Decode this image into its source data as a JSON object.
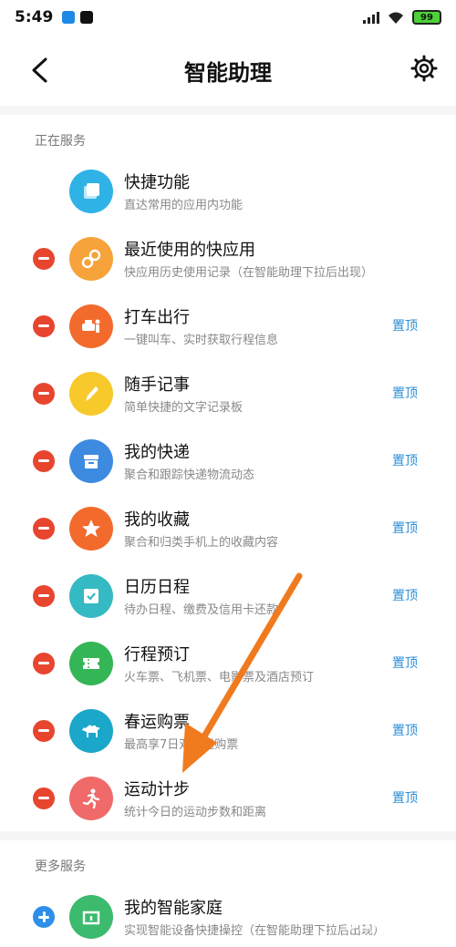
{
  "status": {
    "time": "5:49",
    "battery": "99"
  },
  "header": {
    "title": "智能助理"
  },
  "sections": {
    "serving_title": "正在服务",
    "more_title": "更多服务"
  },
  "items": [
    {
      "title": "快捷功能",
      "sub": "直达常用的应用内功能",
      "color": "#2fb3e6",
      "icon": "layers-icon"
    },
    {
      "title": "最近使用的快应用",
      "sub": "快应用历史使用记录（在智能助理下拉后出现）",
      "color": "#f5a33a",
      "icon": "link-icon"
    },
    {
      "title": "打车出行",
      "sub": "一键叫车、实时获取行程信息",
      "color": "#f26b2c",
      "icon": "car-icon",
      "pin": "置顶"
    },
    {
      "title": "随手记事",
      "sub": "简单快捷的文字记录板",
      "color": "#f7c92b",
      "icon": "pencil-icon",
      "pin": "置顶"
    },
    {
      "title": "我的快递",
      "sub": "聚合和跟踪快递物流动态",
      "color": "#3c8be0",
      "icon": "box-icon",
      "pin": "置顶"
    },
    {
      "title": "我的收藏",
      "sub": "聚合和归类手机上的收藏内容",
      "color": "#f26b2c",
      "icon": "star-icon",
      "pin": "置顶"
    },
    {
      "title": "日历日程",
      "sub": "待办日程、缴费及信用卡还款",
      "color": "#35b9c2",
      "icon": "calendar-icon",
      "pin": "置顶"
    },
    {
      "title": "行程预订",
      "sub": "火车票、飞机票、电影票及酒店预订",
      "color": "#34b556",
      "icon": "ticket-icon",
      "pin": "置顶"
    },
    {
      "title": "春运购票",
      "sub": "最高享7日双通道购票",
      "color": "#1aa7c9",
      "icon": "camel-icon",
      "pin": "置顶"
    },
    {
      "title": "运动计步",
      "sub": "统计今日的运动步数和距离",
      "color": "#f06a6a",
      "icon": "runner-icon",
      "pin": "置顶"
    }
  ],
  "more_items": [
    {
      "title": "我的智能家庭",
      "sub": "实现智能设备快捷操控（在智能助理下拉后出现）",
      "color": "#3cba6e",
      "icon": "mi-home-icon"
    }
  ],
  "watermark": "Baidu经验"
}
